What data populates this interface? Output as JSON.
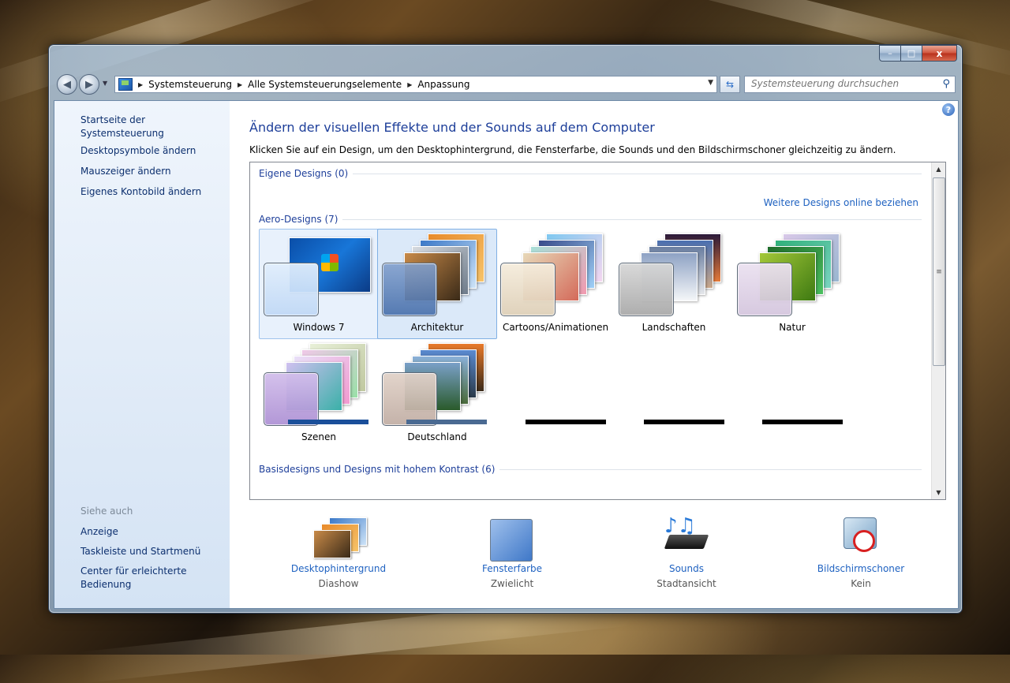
{
  "window": {
    "minimize_label": "–",
    "maximize_label": "□",
    "close_label": "x"
  },
  "navigation": {
    "back_icon": "back-arrow-icon",
    "forward_icon": "forward-arrow-icon",
    "breadcrumb": [
      "Systemsteuerung",
      "Alle Systemsteuerungselemente",
      "Anpassung"
    ],
    "search_placeholder": "Systemsteuerung durchsuchen"
  },
  "sidebar": {
    "top_links": [
      "Startseite der Systemsteuerung",
      "Desktopsymbole ändern",
      "Mauszeiger ändern",
      "Eigenes Kontobild ändern"
    ],
    "see_also_label": "Siehe auch",
    "see_also_links": [
      "Anzeige",
      "Taskleiste und Startmenü",
      "Center für erleichterte Bedienung"
    ]
  },
  "main": {
    "title": "Ändern der visuellen Effekte und der Sounds auf dem Computer",
    "subtitle": "Klicken Sie auf ein Design, um den Desktophintergrund, die Fensterfarbe, die Sounds und den Bildschirmschoner gleichzeitig zu ändern.",
    "own_designs_label": "Eigene Designs (0)",
    "online_link": "Weitere Designs online beziehen",
    "aero_designs_label": "Aero-Designs (7)",
    "themes": [
      {
        "name": "Windows 7"
      },
      {
        "name": "Architektur"
      },
      {
        "name": "Cartoons/Animationen"
      },
      {
        "name": "Landschaften"
      },
      {
        "name": "Natur"
      },
      {
        "name": "Szenen"
      },
      {
        "name": "Deutschland"
      }
    ],
    "basic_designs_label": "Basisdesigns und Designs mit hohem Kontrast (6)"
  },
  "bottom": [
    {
      "label": "Desktophintergrund",
      "value": "Diashow"
    },
    {
      "label": "Fensterfarbe",
      "value": "Zwielicht"
    },
    {
      "label": "Sounds",
      "value": "Stadtansicht"
    },
    {
      "label": "Bildschirmschoner",
      "value": "Kein"
    }
  ]
}
